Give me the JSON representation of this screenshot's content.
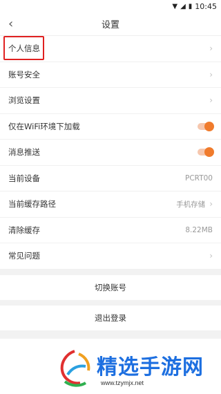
{
  "status": {
    "time": "10:45"
  },
  "header": {
    "back_icon": "chevron-left-icon",
    "title": "设置"
  },
  "settings": {
    "personal_info": "个人信息",
    "account_security": "账号安全",
    "browse_settings": "浏览设置",
    "wifi_only": "仅在WiFi环境下加载",
    "push": "消息推送",
    "current_device": "当前设备",
    "current_device_value": "PCRT00",
    "cache_path": "当前缓存路径",
    "cache_path_value": "手机存储",
    "clear_cache": "清除缓存",
    "clear_cache_value": "8.22MB",
    "faq": "常见问题"
  },
  "actions": {
    "switch_account": "切换账号",
    "logout": "退出登录"
  },
  "colors": {
    "accent": "#f07b2c",
    "highlight": "#e02020",
    "watermark": "#1d6fe0"
  },
  "watermark": {
    "title": "精选手游网",
    "url": "www.tzymjx.net"
  }
}
